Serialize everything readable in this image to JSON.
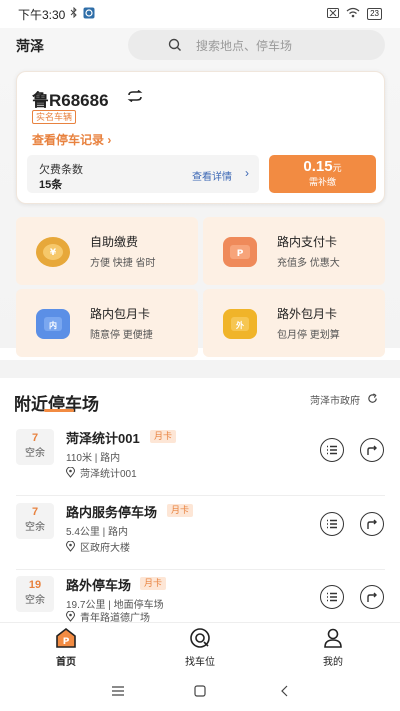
{
  "status_bar": {
    "time": "下午3:30",
    "battery": "23"
  },
  "header": {
    "city": "菏泽",
    "search_placeholder": "搜索地点、停车场"
  },
  "vehicle": {
    "plate": "鲁R68686",
    "badge": "实名车辆",
    "records_link": "查看停车记录",
    "arrears_label": "欠费条数",
    "arrears_count": "15条",
    "arrears_detail": "查看详情",
    "pay_amount": "0.15",
    "pay_unit": "元",
    "pay_label": "需补缴"
  },
  "services": [
    {
      "title": "自助缴费",
      "desc": "方便 快捷 省时",
      "icon": "yen-icon",
      "icon_char": "¥",
      "color": "#e7a83a"
    },
    {
      "title": "路内支付卡",
      "desc": "充值多 优惠大",
      "icon": "parking-card-icon",
      "icon_char": "P",
      "color": "#ef8a5a"
    },
    {
      "title": "路内包月卡",
      "desc": "随意停 更便捷",
      "icon": "inner-card-icon",
      "icon_char": "内",
      "color": "#5b8fe6"
    },
    {
      "title": "路外包月卡",
      "desc": "包月停 更划算",
      "icon": "outer-card-icon",
      "icon_char": "外",
      "color": "#f0b429"
    }
  ],
  "nearby": {
    "title": "附近停车场",
    "location": "菏泽市政府",
    "lots": [
      {
        "count": "7",
        "vacancy": "空余",
        "name": "菏泽统计001",
        "badge": "月卡",
        "info": "110米  |  路内",
        "address": "菏泽统计001"
      },
      {
        "count": "7",
        "vacancy": "空余",
        "name": "路内服务停车场",
        "badge": "月卡",
        "info": "5.4公里  |  路内",
        "address": "区政府大楼"
      },
      {
        "count": "19",
        "vacancy": "空余",
        "name": "路外停车场",
        "badge": "月卡",
        "info": "19.7公里  |  地面停车场",
        "address": "青年路道德广场"
      }
    ]
  },
  "tabs": [
    {
      "label": "首页",
      "icon": "home-parking-icon"
    },
    {
      "label": "找车位",
      "icon": "find-spot-icon"
    },
    {
      "label": "我的",
      "icon": "profile-icon"
    }
  ],
  "colors": {
    "accent": "#f28b42",
    "link": "#3b67b5",
    "card_bg": "#fdf0e4"
  }
}
